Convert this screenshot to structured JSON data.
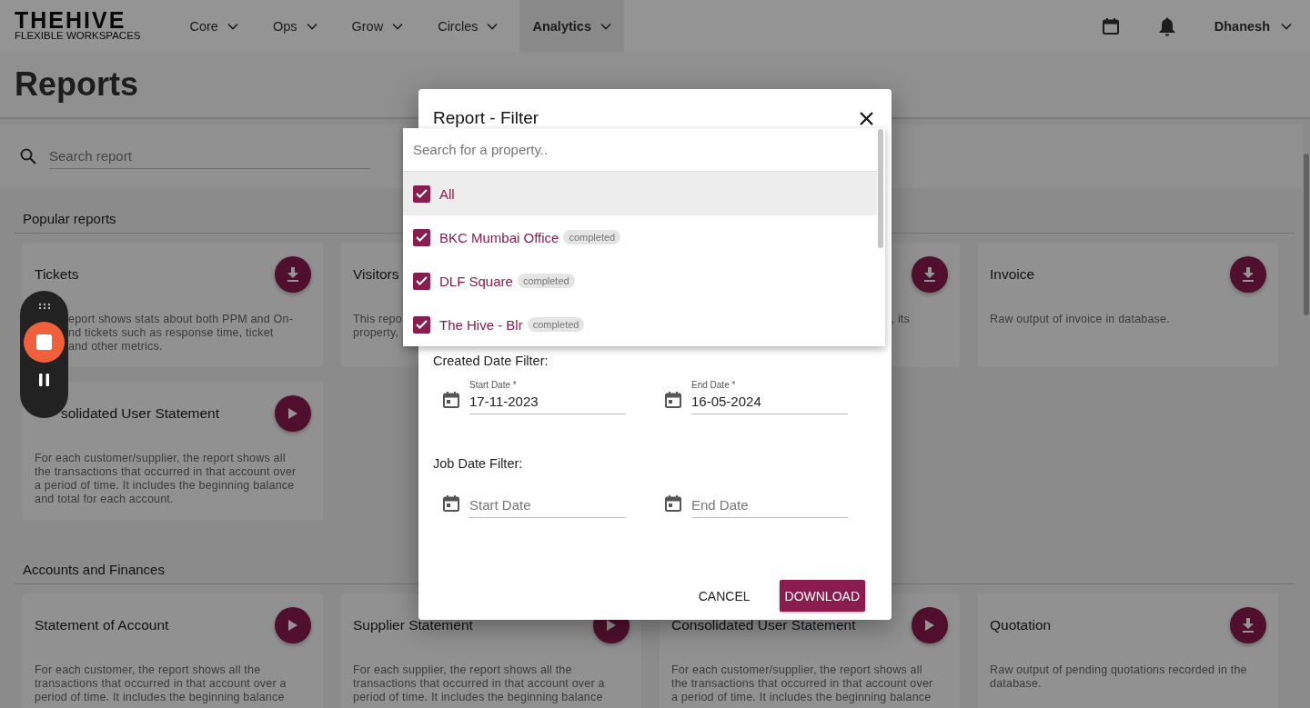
{
  "header": {
    "logo": {
      "title": "THEHIVE",
      "subtitle": "FLEXIBLE WORKSPACES"
    },
    "nav": [
      {
        "label": "Core",
        "selected": false
      },
      {
        "label": "Ops",
        "selected": false
      },
      {
        "label": "Grow",
        "selected": false
      },
      {
        "label": "Circles",
        "selected": false
      },
      {
        "label": "Analytics",
        "selected": true
      }
    ],
    "user": "Dhanesh"
  },
  "page_title": "Reports",
  "search": {
    "placeholder": "Search report"
  },
  "sections": [
    {
      "title": "Popular reports",
      "cards": [
        {
          "title": "Tickets",
          "kind": "download",
          "lines": [
            "eport shows stats about both PPM and On-",
            "nd tickets such as response time, ticket",
            "and other metrics."
          ]
        },
        {
          "title": "Visitors",
          "lines": [
            "This repo",
            "property,"
          ]
        },
        {
          "kind": "download",
          "lines": [
            ", its"
          ]
        },
        {
          "title": "Invoice",
          "kind": "download",
          "lines": [
            "Raw output of invoice in database."
          ]
        },
        {
          "title": "solidated User Statement",
          "kind": "run",
          "lines": [
            "For each customer/supplier, the report shows all",
            "the transactions that occurred in that account over",
            "a period of time. It includes the beginning balance",
            "and total for each account."
          ]
        }
      ]
    },
    {
      "title": "Accounts and Finances",
      "cards": [
        {
          "title": "Statement of Account",
          "kind": "run",
          "lines": [
            "For each customer, the report shows all the",
            "transactions that occurred in that account over a",
            "period of time. It includes the beginning balance"
          ]
        },
        {
          "title": "Supplier Statement",
          "kind": "run",
          "lines": [
            "For each supplier, the report shows all the",
            "transactions that occurred in that account over a",
            "period of time. It includes the beginning balance"
          ]
        },
        {
          "title": "Consolidated User Statement",
          "kind": "run",
          "lines": [
            "For each customer/supplier, the report shows all",
            "the transactions that occurred in that account over",
            "a period of time. It includes the beginning balance"
          ]
        },
        {
          "title": "Quotation",
          "kind": "download",
          "lines": [
            "Raw output of pending quotations recorded in the",
            "database."
          ]
        }
      ]
    }
  ],
  "dialog": {
    "title": "Report - Filter",
    "property_search": {
      "placeholder": "Search for a property.."
    },
    "properties": [
      {
        "name": "All",
        "checked": true,
        "active": true
      },
      {
        "name": "BKC Mumbai Office",
        "status": "completed",
        "checked": true,
        "active": false
      },
      {
        "name": "DLF Square",
        "status": "completed",
        "checked": true,
        "active": false
      },
      {
        "name": "The Hive - Blr",
        "status": "completed",
        "checked": true,
        "active": false
      }
    ],
    "date_filters": [
      {
        "label": "Created Date Filter:",
        "fields": [
          {
            "label": "Start Date *",
            "value": "17-11-2023"
          },
          {
            "label": "End Date *",
            "value": "16-05-2024"
          }
        ]
      },
      {
        "label": "Job Date Filter:",
        "fields": [
          {
            "placeholder": "Start Date"
          },
          {
            "placeholder": "End Date"
          }
        ]
      }
    ],
    "buttons": [
      {
        "label": "CANCEL",
        "kind": "text"
      },
      {
        "label": "DOWNLOAD",
        "kind": "primary"
      }
    ]
  }
}
